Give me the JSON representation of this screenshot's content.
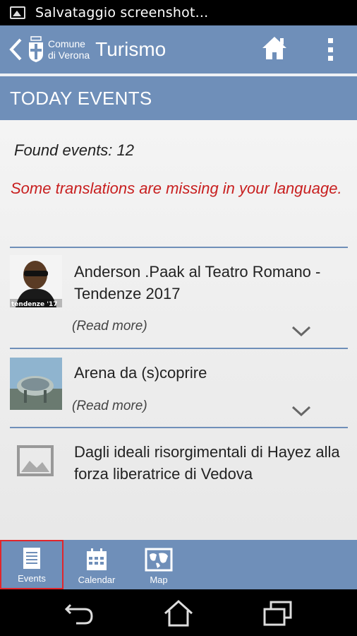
{
  "status_bar": {
    "text": "Salvataggio screenshot..."
  },
  "action_bar": {
    "logo_line1": "Comune",
    "logo_line2": "di Verona",
    "title": "Turismo"
  },
  "section": {
    "title": "TODAY EVENTS"
  },
  "content": {
    "found_text": "Found events: 12",
    "warning_text": "Some translations are missing in your language."
  },
  "events": [
    {
      "title": "Anderson .Paak al Teatro Romano -Tendenze 2017",
      "read_more": "(Read more)",
      "thumb_caption": "tendenze '17"
    },
    {
      "title": "Arena da (s)coprire",
      "read_more": "(Read more)"
    },
    {
      "title": "Dagli ideali risorgimentali di Hayez alla forza liberatrice di Vedova"
    }
  ],
  "tabs": [
    {
      "label": "Events",
      "active": true
    },
    {
      "label": "Calendar",
      "active": false
    },
    {
      "label": "Map",
      "active": false
    }
  ],
  "colors": {
    "bar": "#6f8fb9",
    "warning": "#c81f1f",
    "active_tab_border": "#e1262b"
  }
}
